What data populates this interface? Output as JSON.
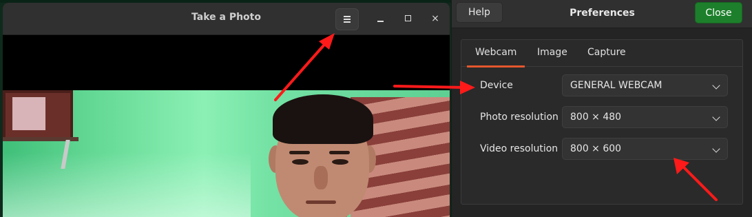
{
  "photo_window": {
    "title": "Take a Photo",
    "menu_icon": "hamburger-menu-icon",
    "minimize_icon": "minimize-icon",
    "maximize_icon": "maximize-icon",
    "close_glyph": "×"
  },
  "preferences": {
    "title": "Preferences",
    "help_label": "Help",
    "close_label": "Close",
    "accent_close_color": "#1d7f2b",
    "tab_indicator_color": "#e4572e",
    "tabs": [
      {
        "label": "Webcam",
        "active": true
      },
      {
        "label": "Image",
        "active": false
      },
      {
        "label": "Capture",
        "active": false
      }
    ],
    "rows": [
      {
        "label": "Device",
        "value": "GENERAL WEBCAM"
      },
      {
        "label": "Photo resolution",
        "value": "800 × 480"
      },
      {
        "label": "Video resolution",
        "value": "800 × 600"
      }
    ]
  },
  "annotations": {
    "arrow_color": "#ff1a1a"
  }
}
